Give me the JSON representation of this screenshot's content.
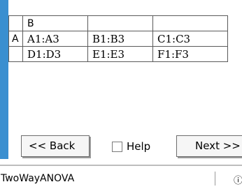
{
  "sheet": {
    "header": [
      "",
      "B",
      "",
      ""
    ],
    "rows": [
      {
        "label": "A",
        "cells": [
          "A1:A3",
          "B1:B3",
          "C1:C3"
        ]
      },
      {
        "label": "",
        "cells": [
          "D1:D3",
          "E1:E3",
          "F1:F3"
        ]
      }
    ]
  },
  "buttons": {
    "back": "<< Back",
    "help": "Help",
    "next": "Next >>"
  },
  "status": {
    "title": "TwoWayANOVA",
    "battery_glyph": "ⓘ"
  },
  "colors": {
    "accent": "#3a8fd0"
  }
}
